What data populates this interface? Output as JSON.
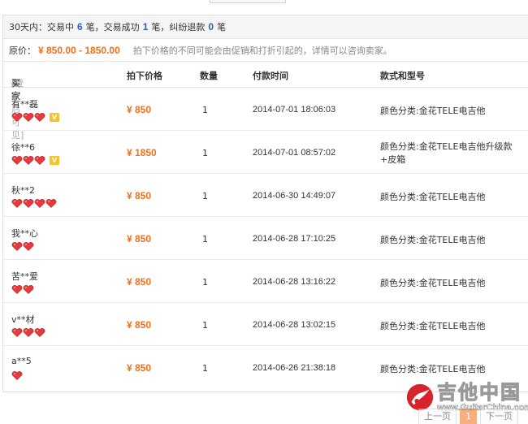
{
  "summary": {
    "prefix": "30天内：交易中",
    "in_progress": "6",
    "sep1": "笔，交易成功",
    "success": "1",
    "sep2": "笔，纠纷退款",
    "refund": "0",
    "suffix": "笔"
  },
  "price_info": {
    "label": "原价：",
    "range": "¥ 850.00 - 1850.00",
    "note": "拍下价格的不同可能会由促销和打折引起的，详情可以咨询卖家。"
  },
  "table": {
    "headers": {
      "buyer": "买家",
      "buyer_hint": "[登录后可见]",
      "price": "拍下价格",
      "qty": "数量",
      "time": "付款时间",
      "style": "款式和型号"
    },
    "rows": [
      {
        "buyer": "有**磊",
        "hearts": 3,
        "vip": true,
        "price": "¥ 850",
        "qty": "1",
        "time": "2014-07-01 18:06:03",
        "style": "颜色分类:金花TELE电吉他"
      },
      {
        "buyer": "徐**6",
        "hearts": 3,
        "vip": true,
        "price": "¥ 1850",
        "qty": "1",
        "time": "2014-07-01 08:57:02",
        "style": "颜色分类:金花TELE电吉他升级款+皮箱"
      },
      {
        "buyer": "秋**2",
        "hearts": 4,
        "vip": false,
        "price": "¥ 850",
        "qty": "1",
        "time": "2014-06-30 14:49:07",
        "style": "颜色分类:金花TELE电吉他"
      },
      {
        "buyer": "我**心",
        "hearts": 2,
        "vip": false,
        "price": "¥ 850",
        "qty": "1",
        "time": "2014-06-28 17:10:25",
        "style": "颜色分类:金花TELE电吉他"
      },
      {
        "buyer": "苦**爱",
        "hearts": 2,
        "vip": false,
        "price": "¥ 850",
        "qty": "1",
        "time": "2014-06-28 13:16:22",
        "style": "颜色分类:金花TELE电吉他"
      },
      {
        "buyer": "v**材",
        "hearts": 3,
        "vip": false,
        "price": "¥ 850",
        "qty": "1",
        "time": "2014-06-28 13:02:15",
        "style": "颜色分类:金花TELE电吉他"
      },
      {
        "buyer": "a**5",
        "hearts": 1,
        "vip": false,
        "price": "¥ 850",
        "qty": "1",
        "time": "2014-06-26 21:38:18",
        "style": "颜色分类:金花TELE电吉他"
      }
    ]
  },
  "pager": {
    "prev": "上一页",
    "current": "1",
    "next": "下一页"
  },
  "watermark": {
    "cn": "吉他中国",
    "en": "www.GuitarChina.com"
  },
  "colors": {
    "accent": "#f36f1a",
    "count": "#2a62b8",
    "heart": "#e8393d",
    "vip": "#f5c32b"
  }
}
